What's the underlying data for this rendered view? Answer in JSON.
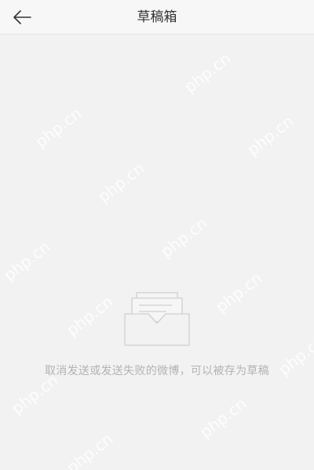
{
  "nav": {
    "title": "草稿箱",
    "back_icon": "arrow-left-icon"
  },
  "empty_state": {
    "icon": "inbox-tray-icon",
    "message": "取消发送或发送失败的微博，可以被存为草稿"
  },
  "watermark": {
    "text": "php.cn"
  },
  "colors": {
    "background": "#f2f2f2",
    "nav_background": "#f7f7f7",
    "title_text": "#333333",
    "hint_text": "#b3b3b3",
    "icon_stroke": "#cfcfcf"
  }
}
